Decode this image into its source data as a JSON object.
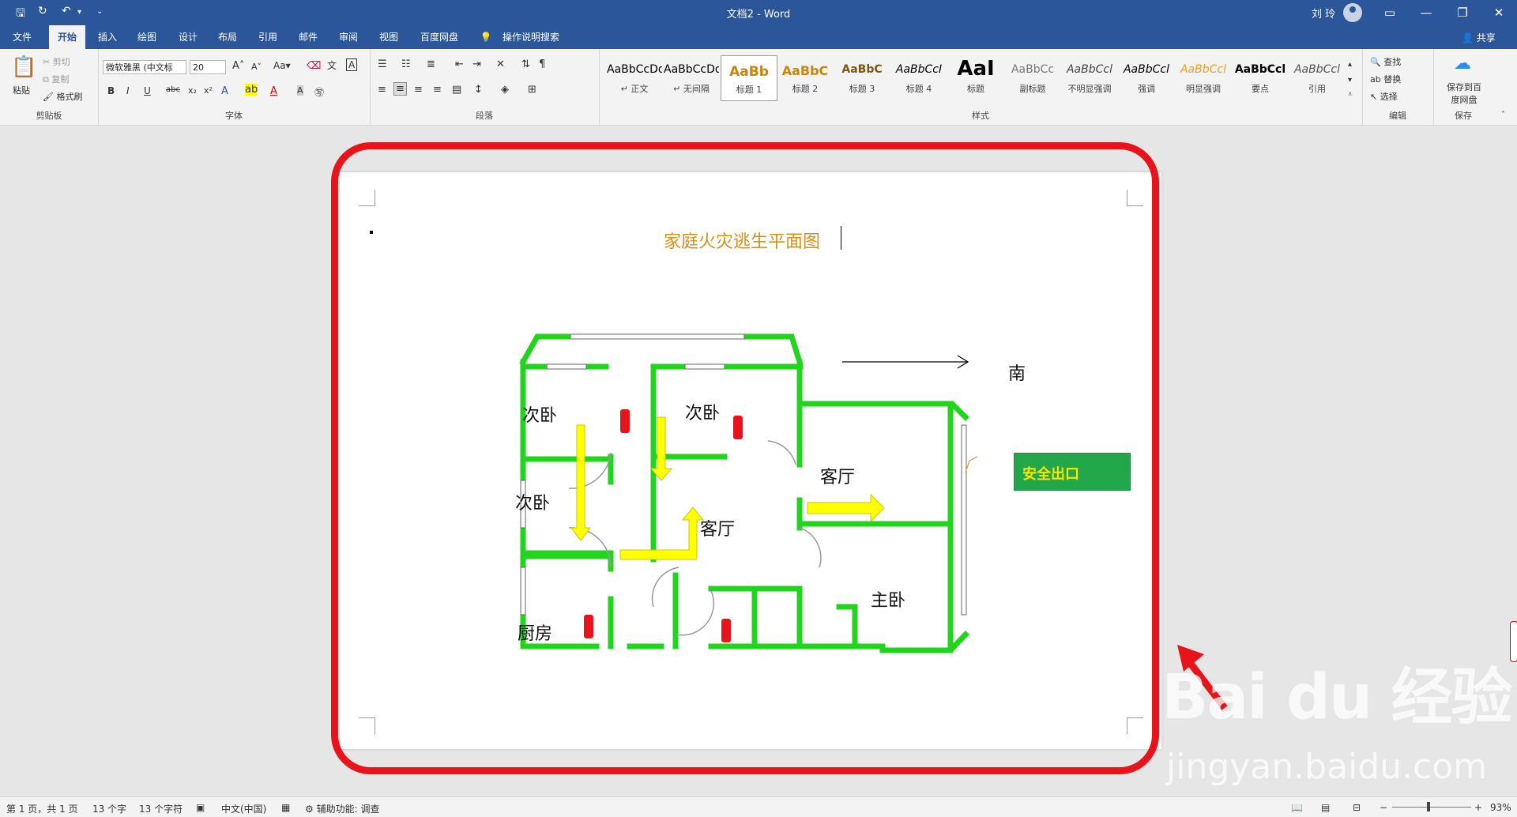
{
  "titlebar": {
    "doc_title": "文档2 - Word",
    "user_name": "刘 玲",
    "minimize": "—",
    "restore": "❐",
    "close": "✕",
    "ribbon_display": "▭"
  },
  "tabs": [
    {
      "label": "文件"
    },
    {
      "label": "开始"
    },
    {
      "label": "插入"
    },
    {
      "label": "绘图"
    },
    {
      "label": "设计"
    },
    {
      "label": "布局"
    },
    {
      "label": "引用"
    },
    {
      "label": "邮件"
    },
    {
      "label": "审阅"
    },
    {
      "label": "视图"
    },
    {
      "label": "百度网盘"
    },
    {
      "label": "操作说明搜索"
    }
  ],
  "share_label": "共享",
  "clipboard": {
    "paste": "粘贴",
    "cut": "剪切",
    "copy": "复制",
    "format_painter": "格式刷",
    "group": "剪贴板"
  },
  "font": {
    "name": "微软雅黑 (中文标",
    "size": "20",
    "group": "字体"
  },
  "paragraph": {
    "group": "段落"
  },
  "styles": {
    "group": "样式",
    "items": [
      {
        "preview": "AaBbCcDd",
        "name": "↵ 正文",
        "color": "#222222"
      },
      {
        "preview": "AaBbCcDd",
        "name": "↵ 无间隔",
        "color": "#222222"
      },
      {
        "preview": "AaBb",
        "name": "标题 1",
        "color": "#c8840c"
      },
      {
        "preview": "AaBbC",
        "name": "标题 2",
        "color": "#c8840c"
      },
      {
        "preview": "AaBbC",
        "name": "标题 3",
        "color": "#7a5a10"
      },
      {
        "preview": "AaBbCcI",
        "name": "标题 4",
        "color": "#222222"
      },
      {
        "preview": "AaI",
        "name": "标题",
        "color": "#000000"
      },
      {
        "preview": "AaBbCc",
        "name": "副标题",
        "color": "#777777"
      },
      {
        "preview": "AaBbCcl",
        "name": "不明显强调",
        "color": "#444444"
      },
      {
        "preview": "AaBbCcl",
        "name": "强调",
        "color": "#222222"
      },
      {
        "preview": "AaBbCcl",
        "name": "明显强调",
        "color": "#f0a020"
      },
      {
        "preview": "AaBbCcl",
        "name": "要点",
        "color": "#000000"
      },
      {
        "preview": "AaBbCcl",
        "name": "引用",
        "color": "#555555"
      }
    ]
  },
  "editing": {
    "find": "查找",
    "replace": "替换",
    "select": "选择",
    "group": "编辑"
  },
  "save_group": {
    "button": "保存到百度网盘",
    "group": "保存"
  },
  "document": {
    "heading": "家庭火灾逃生平面图",
    "south": "南",
    "exit_label": "安全出口",
    "rooms": [
      "次卧",
      "次卧",
      "次卧",
      "客厅",
      "客厅",
      "厨房",
      "主卧"
    ]
  },
  "status": {
    "page": "第 1 页，共 1 页",
    "words": "13 个字",
    "chars": "13 个字符",
    "language": "中文(中国)",
    "accessibility": "辅助功能: 调查",
    "zoom": "93%"
  },
  "watermark": {
    "logo": "Bai du 经验",
    "url": "jingyan.baidu.com"
  },
  "colors": {
    "accent": "#2b579a",
    "wall": "#22d41e",
    "arrow": "#ffff00",
    "ring": "#e8141c",
    "exit": "#22a84a"
  }
}
